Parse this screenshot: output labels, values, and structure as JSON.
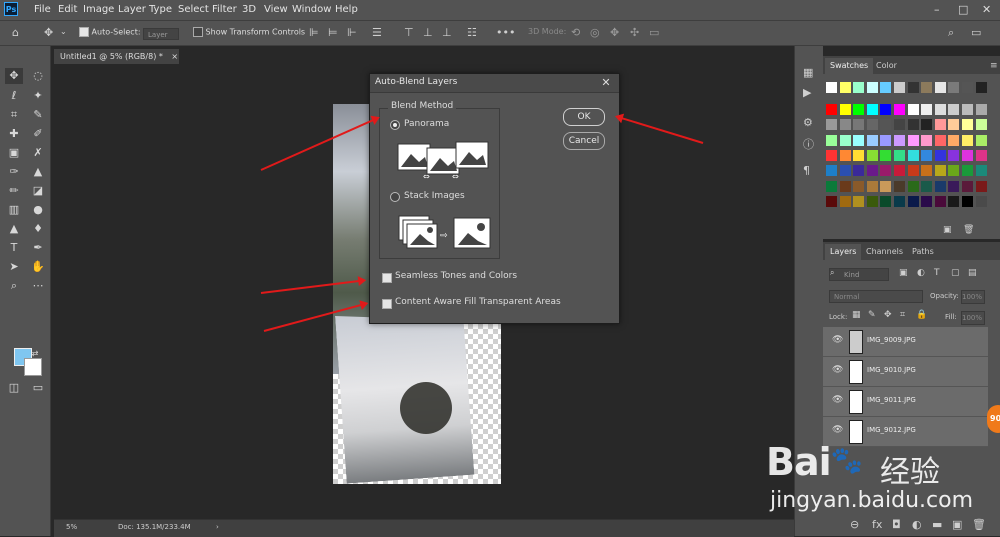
{
  "app": {
    "logo": "Ps"
  },
  "menu": [
    "File",
    "Edit",
    "Image",
    "Layer",
    "Type",
    "Select",
    "Filter",
    "3D",
    "View",
    "Window",
    "Help"
  ],
  "window_controls": {
    "minimize": "–",
    "maximize": "□",
    "close": "✕"
  },
  "options": {
    "auto_select_label": "Auto-Select:",
    "auto_select_checked": true,
    "layer_dropdown": "Layer",
    "show_transform_label": "Show Transform Controls",
    "mode_3d_label": "3D Mode:"
  },
  "document": {
    "tab_title": "Untitled1 @ 5% (RGB/8) *",
    "tab_close": "×"
  },
  "status": {
    "zoom": "5%",
    "doc_info": "Doc: 135.1M/233.4M",
    "arrow": "›"
  },
  "swatches_panel": {
    "tabs": [
      "Swatches",
      "Color"
    ],
    "row1": [
      "#ffffff",
      "#ffff66",
      "#99ffcc",
      "#ccffff",
      "#66ccff",
      "#cccccc",
      "#333333",
      "#8c7a5c",
      "#e6e6e6",
      "#7a7a7a",
      "#555555",
      "#222222"
    ],
    "grid": [
      [
        "#ff0000",
        "#ffff00",
        "#00ff00",
        "#00ffff",
        "#0000ff",
        "#ff00ff",
        "#ffffff",
        "#eeeeee",
        "#dddddd",
        "#cccccc",
        "#bbbbbb",
        "#aaaaaa"
      ],
      [
        "#999999",
        "#888888",
        "#777777",
        "#666666",
        "#555555",
        "#444444",
        "#333333",
        "#222222",
        "#ff9999",
        "#ffcc99",
        "#ffff99",
        "#ccff99"
      ],
      [
        "#99ff99",
        "#99ffcc",
        "#99ffff",
        "#99ccff",
        "#9999ff",
        "#cc99ff",
        "#ff99ff",
        "#ff99cc",
        "#ff6666",
        "#ffaa66",
        "#ffee66",
        "#aaee66"
      ],
      [
        "#ff3333",
        "#ff8833",
        "#ffdd33",
        "#88dd33",
        "#33dd33",
        "#33dd88",
        "#33dddd",
        "#3388dd",
        "#3333dd",
        "#8833dd",
        "#dd33dd",
        "#dd3388"
      ],
      [
        "#1e7fc8",
        "#2a4fb0",
        "#3a2a9a",
        "#6a1a8a",
        "#9a1a6a",
        "#c81a3a",
        "#c83a1a",
        "#c8701a",
        "#b8a81a",
        "#6aa81a",
        "#1a9a3a",
        "#1a8a7a"
      ],
      [
        "#0a7a3a",
        "#6a3a1a",
        "#8a5a2a",
        "#aa7a3a",
        "#ca9a5a",
        "#4a3a2a",
        "#2a6a1a",
        "#1a5a4a",
        "#1a3a6a",
        "#3a1a5a",
        "#5a1a3a",
        "#7a1a1a"
      ],
      [
        "#5a0a0a",
        "#a06a10",
        "#b09020",
        "#3a5a0a",
        "#0a4a2a",
        "#0a3a4a",
        "#0a1a4a",
        "#2a0a4a",
        "#4a0a3a",
        "#1a1a1a",
        "#000000",
        "#4a4a4a"
      ]
    ]
  },
  "layers_panel": {
    "tabs": [
      "Layers",
      "Channels",
      "Paths"
    ],
    "kind_filter": "Kind",
    "blend_mode": "Normal",
    "opacity_label": "Opacity:",
    "opacity_value": "100%",
    "lock_label": "Lock:",
    "fill_label": "Fill:",
    "fill_value": "100%",
    "layers": [
      "IMG_9009.JPG",
      "IMG_9010.JPG",
      "IMG_9011.JPG",
      "IMG_9012.JPG"
    ]
  },
  "dialog": {
    "title": "Auto-Blend Layers",
    "close": "✕",
    "group_label": "Blend Method",
    "option_panorama": "Panorama",
    "option_stack": "Stack Images",
    "selected": "Panorama",
    "seamless_label": "Seamless Tones and Colors",
    "seamless_checked": true,
    "content_aware_label": "Content Aware Fill Transparent Areas",
    "content_aware_checked": true,
    "ok": "OK",
    "cancel": "Cancel"
  },
  "watermark": {
    "logo": "Bai",
    "paw": "du",
    "cn": "经验",
    "url": "jingyan.baidu.com"
  },
  "badge": {
    "text": "90"
  },
  "colors": {
    "fg": "#7fc6f0",
    "bg": "#ffffff",
    "arrow": "#e11a1a"
  }
}
